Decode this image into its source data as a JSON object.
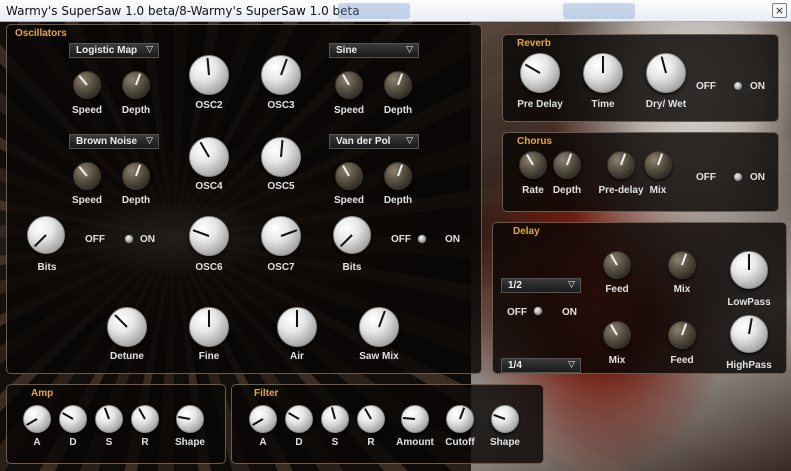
{
  "window": {
    "title": "Warmy's SuperSaw 1.0 beta/8-Warmy's SuperSaw 1.0 beta",
    "close_icon": "close-icon"
  },
  "oscillators": {
    "title": "Oscillators",
    "dropdowns": {
      "mod1": "Logistic Map",
      "mod2": "Sine",
      "mod3": "Brown Noise",
      "mod4": "Van der Pol"
    },
    "labels": {
      "speed": "Speed",
      "depth": "Depth",
      "osc2": "OSC2",
      "osc3": "OSC3",
      "osc4": "OSC4",
      "osc5": "OSC5",
      "osc6": "OSC6",
      "osc7": "OSC7",
      "bits": "Bits",
      "off": "OFF",
      "on": "ON",
      "detune": "Detune",
      "fine": "Fine",
      "air": "Air",
      "saw_mix": "Saw Mix"
    }
  },
  "reverb": {
    "title": "Reverb",
    "pre_delay": "Pre Delay",
    "time": "Time",
    "dry_wet": "Dry/ Wet",
    "off": "OFF",
    "on": "ON"
  },
  "chorus": {
    "title": "Chorus",
    "rate": "Rate",
    "depth": "Depth",
    "pre_delay": "Pre-delay",
    "mix": "Mix",
    "off": "OFF",
    "on": "ON"
  },
  "delay": {
    "title": "Delay",
    "time1": "1/2",
    "time2": "1/4",
    "feed": "Feed",
    "mix": "Mix",
    "lowpass": "LowPass",
    "highpass": "HighPass",
    "off": "OFF",
    "on": "ON"
  },
  "amp": {
    "title": "Amp",
    "a": "A",
    "d": "D",
    "s": "S",
    "r": "R",
    "shape": "Shape"
  },
  "filter": {
    "title": "Filter",
    "a": "A",
    "d": "D",
    "s": "S",
    "r": "R",
    "amount": "Amount",
    "cutoff": "Cutoff",
    "shape": "Shape"
  },
  "dropdown_caret": "▽"
}
